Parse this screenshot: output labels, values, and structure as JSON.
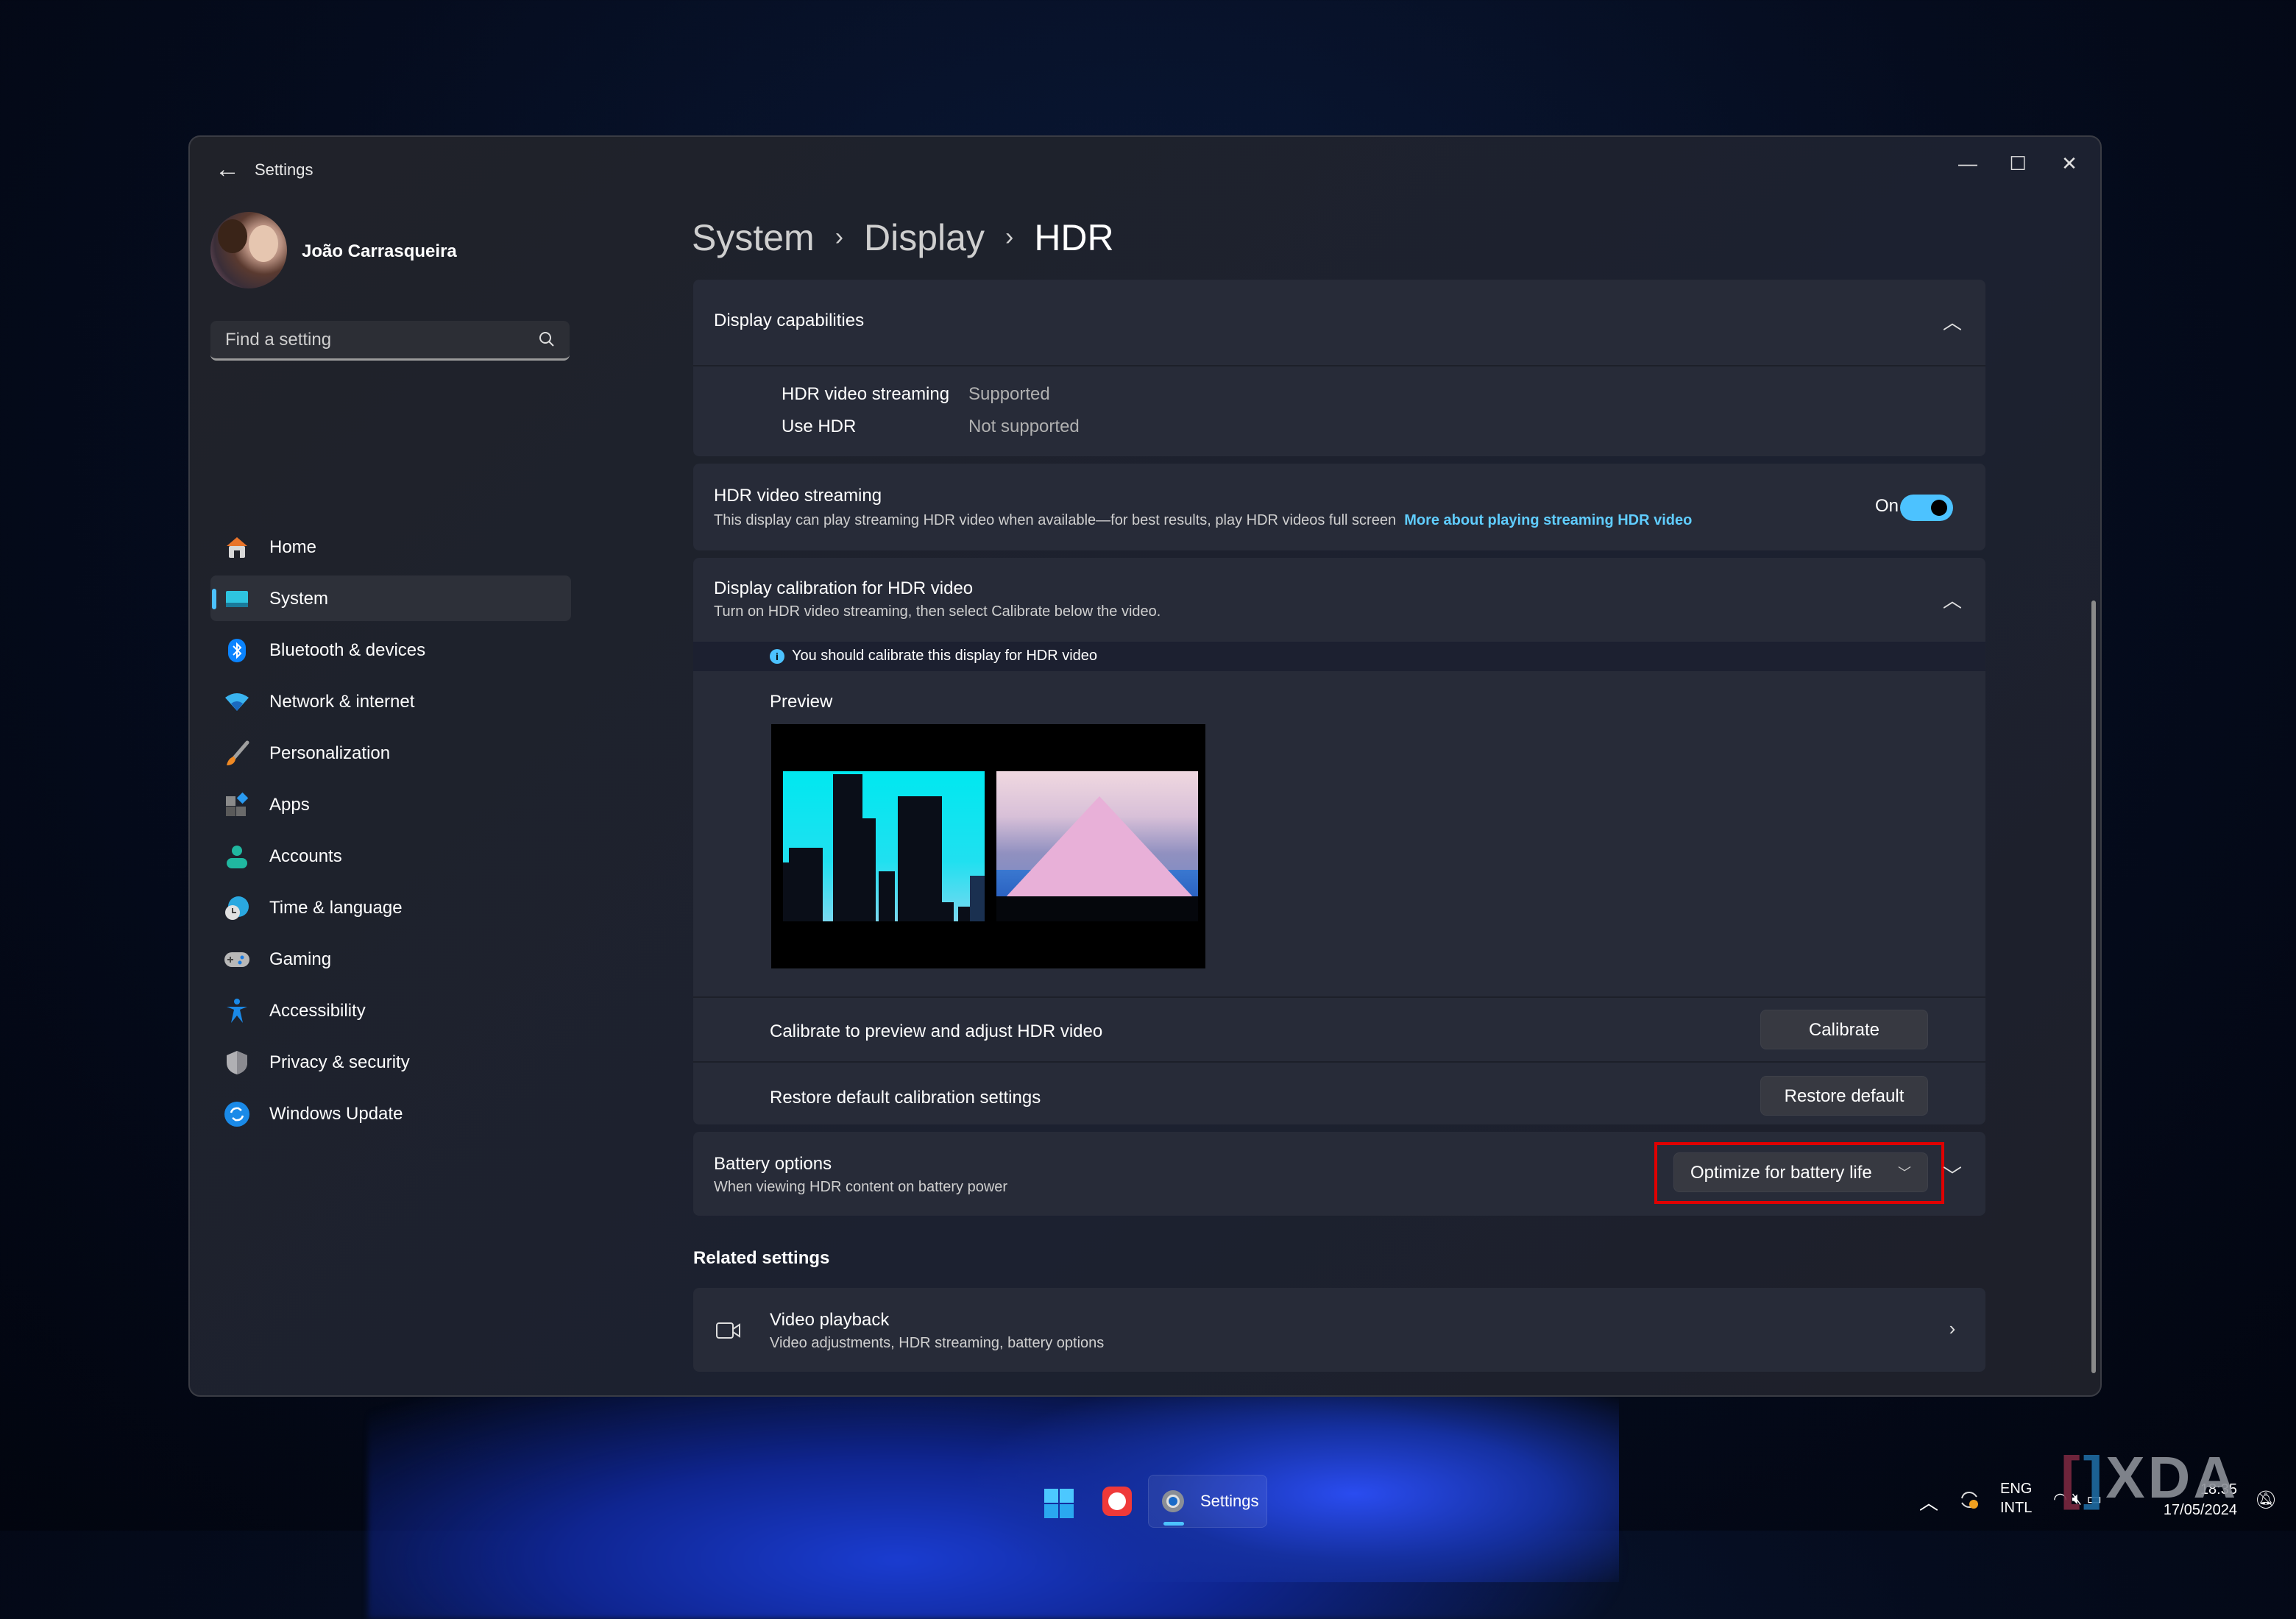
{
  "window": {
    "title": "Settings",
    "controls": {
      "minimize": "—",
      "maximize": "☐",
      "close": "✕"
    }
  },
  "profile": {
    "name": "João Carrasqueira"
  },
  "search": {
    "placeholder": "Find a setting"
  },
  "sidebar": {
    "items": [
      {
        "label": "Home",
        "icon": "home-icon",
        "active": false
      },
      {
        "label": "System",
        "icon": "system-icon",
        "active": true
      },
      {
        "label": "Bluetooth & devices",
        "icon": "bluetooth-icon",
        "active": false
      },
      {
        "label": "Network & internet",
        "icon": "wifi-icon",
        "active": false
      },
      {
        "label": "Personalization",
        "icon": "brush-icon",
        "active": false
      },
      {
        "label": "Apps",
        "icon": "apps-icon",
        "active": false
      },
      {
        "label": "Accounts",
        "icon": "person-icon",
        "active": false
      },
      {
        "label": "Time & language",
        "icon": "globe-clock-icon",
        "active": false
      },
      {
        "label": "Gaming",
        "icon": "gamepad-icon",
        "active": false
      },
      {
        "label": "Accessibility",
        "icon": "accessibility-icon",
        "active": false
      },
      {
        "label": "Privacy & security",
        "icon": "shield-icon",
        "active": false
      },
      {
        "label": "Windows Update",
        "icon": "update-icon",
        "active": false
      }
    ]
  },
  "breadcrumb": {
    "items": [
      "System",
      "Display",
      "HDR"
    ],
    "separator": "›"
  },
  "display_capabilities": {
    "title": "Display capabilities",
    "rows": [
      {
        "label": "HDR video streaming",
        "value": "Supported"
      },
      {
        "label": "Use HDR",
        "value": "Not supported"
      }
    ]
  },
  "hdr_streaming": {
    "title": "HDR video streaming",
    "description": "This display can play streaming HDR video when available—for best results, play HDR videos full screen",
    "link": "More about playing streaming HDR video",
    "toggle_label": "On",
    "toggle_on": true
  },
  "calibration": {
    "title": "Display calibration for HDR video",
    "description": "Turn on HDR video streaming, then select Calibrate below the video.",
    "info": "You should calibrate this display for HDR video",
    "preview_label": "Preview",
    "calibrate_row": "Calibrate to preview and adjust HDR video",
    "calibrate_button": "Calibrate",
    "restore_row": "Restore default calibration settings",
    "restore_button": "Restore default"
  },
  "battery": {
    "title": "Battery options",
    "description": "When viewing HDR content on battery power",
    "selected": "Optimize for battery life"
  },
  "related": {
    "heading": "Related settings",
    "items": [
      {
        "title": "Video playback",
        "description": "Video adjustments, HDR streaming, battery options"
      }
    ]
  },
  "taskbar": {
    "apps": [
      {
        "name": "Start"
      },
      {
        "name": "Vivaldi"
      },
      {
        "name": "Settings",
        "label": "Settings",
        "active": true
      }
    ],
    "tray": {
      "language_top": "ENG",
      "language_bottom": "INTL",
      "time": "18:35",
      "date": "17/05/2024"
    }
  },
  "watermark": {
    "text": "XDA"
  },
  "colors": {
    "accent": "#4cc2ff",
    "highlight": "#e00000",
    "link": "#60cdff"
  }
}
